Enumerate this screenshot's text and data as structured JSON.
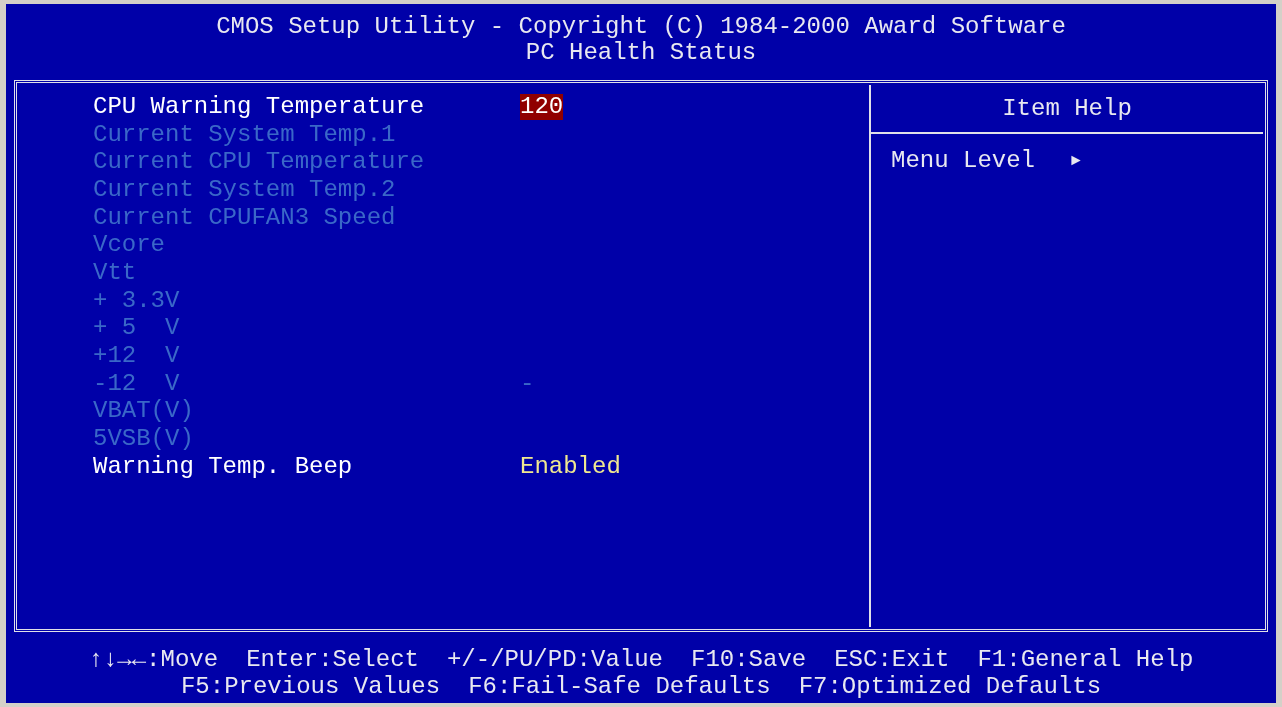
{
  "header": {
    "title": "CMOS Setup Utility - Copyright (C) 1984-2000 Award Software",
    "subtitle": "PC Health Status"
  },
  "settings": [
    {
      "label": "CPU Warning Temperature",
      "value": "120",
      "disabled": false,
      "selected": true
    },
    {
      "label": "Current System Temp.1",
      "disabled": true
    },
    {
      "label": "Current CPU Temperature",
      "disabled": true
    },
    {
      "label": "Current System Temp.2",
      "disabled": true
    },
    {
      "label": "Current CPUFAN3 Speed",
      "disabled": true
    },
    {
      "label": "Vcore",
      "disabled": true
    },
    {
      "label": "Vtt",
      "disabled": true
    },
    {
      "label": "+ 3.3V",
      "disabled": true
    },
    {
      "label": "+ 5  V",
      "disabled": true
    },
    {
      "label": "+12  V",
      "disabled": true
    },
    {
      "label": "-12  V",
      "value": "-",
      "disabled": true,
      "selected": false
    },
    {
      "label": "VBAT(V)",
      "disabled": true
    },
    {
      "label": "5VSB(V)",
      "disabled": true
    },
    {
      "label": "Warning Temp. Beep",
      "value": "Enabled",
      "disabled": false,
      "selected": false
    }
  ],
  "item_help": {
    "title": "Item Help",
    "menu_level_label": "Menu Level",
    "menu_level_marker": "►"
  },
  "key_hints": [
    [
      "↑↓→←:Move",
      "Enter:Select",
      "+/-/PU/PD:Value",
      "F10:Save",
      "ESC:Exit",
      "F1:General Help"
    ],
    [
      "F5:Previous Values",
      "F6:Fail-Safe Defaults",
      "F7:Optimized Defaults"
    ]
  ]
}
